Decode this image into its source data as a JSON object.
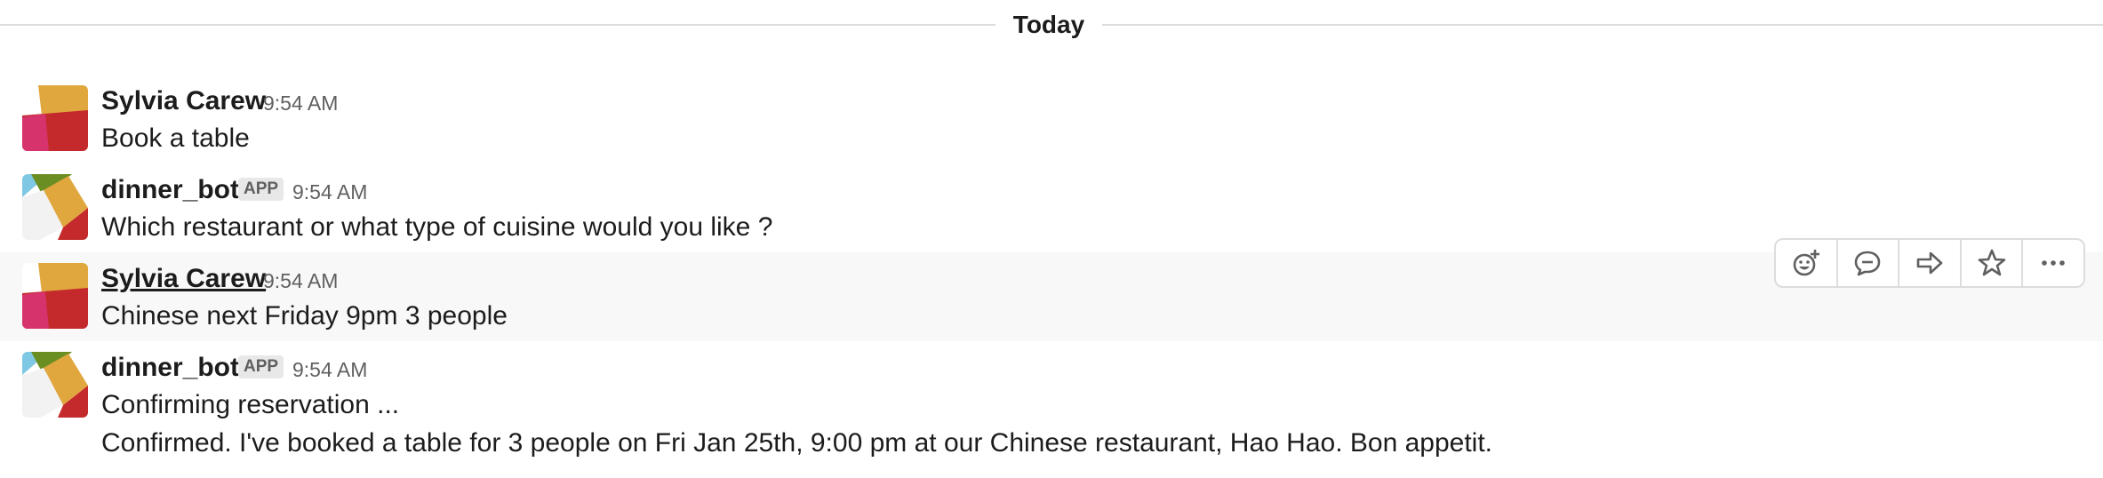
{
  "divider": {
    "label": "Today"
  },
  "messages": [
    {
      "sender": "Sylvia Carew",
      "time": "9:54 AM",
      "lines": [
        "Book a table"
      ]
    },
    {
      "sender": "dinner_bot",
      "badge": "APP",
      "time": "9:54 AM",
      "lines": [
        "Which restaurant or what type of cuisine would you like ?"
      ]
    },
    {
      "sender": "Sylvia Carew",
      "time": "9:54 AM",
      "lines": [
        "Chinese next Friday 9pm 3 people"
      ]
    },
    {
      "sender": "dinner_bot",
      "badge": "APP",
      "time": "9:54 AM",
      "lines": [
        "Confirming reservation ...",
        "Confirmed. I've booked a table for 3 people on Fri Jan 25th, 9:00 pm at our Chinese restaurant, Hao Hao. Bon appetit."
      ]
    }
  ],
  "toolbar": {
    "icons": [
      "add-reaction-icon",
      "reply-thread-icon",
      "share-icon",
      "star-icon",
      "more-actions-icon"
    ]
  },
  "colors": {
    "text": "#1d1c1d",
    "muted": "#616061",
    "hover_bg": "#f8f8f8",
    "border": "#dddddd",
    "avatar_orange": "#e0a73e",
    "avatar_red": "#c42a2b",
    "avatar_pink": "#d6336c",
    "avatar_green": "#6b8e23",
    "avatar_blue": "#7ec8e3"
  }
}
